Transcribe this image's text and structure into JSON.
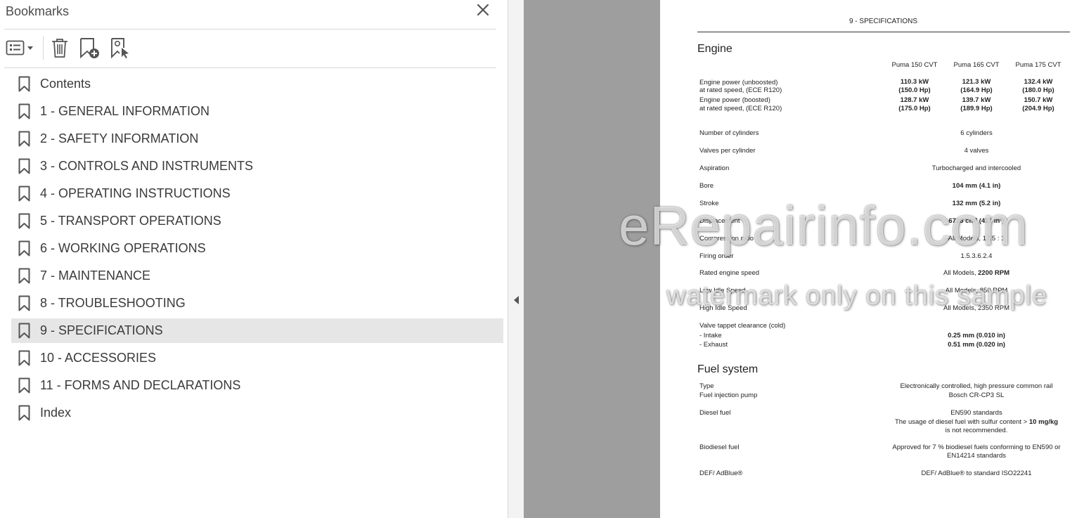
{
  "panel": {
    "title": "Bookmarks",
    "bookmarks": [
      {
        "label": "Contents"
      },
      {
        "label": "1 - GENERAL INFORMATION"
      },
      {
        "label": "2 - SAFETY INFORMATION"
      },
      {
        "label": "3 - CONTROLS AND INSTRUMENTS"
      },
      {
        "label": "4 - OPERATING INSTRUCTIONS"
      },
      {
        "label": "5 - TRANSPORT OPERATIONS"
      },
      {
        "label": "6 - WORKING OPERATIONS"
      },
      {
        "label": "7 - MAINTENANCE"
      },
      {
        "label": "8 - TROUBLESHOOTING"
      },
      {
        "label": "9 - SPECIFICATIONS",
        "selected": true
      },
      {
        "label": "10 - ACCESSORIES"
      },
      {
        "label": "11 - FORMS AND DECLARATIONS"
      },
      {
        "label": "Index"
      }
    ]
  },
  "page": {
    "header": "9 - SPECIFICATIONS",
    "engine": {
      "title": "Engine",
      "columns": [
        "Puma 150 CVT",
        "Puma 165 CVT",
        "Puma 175 CVT"
      ],
      "power_unboosted": {
        "label1": "Engine power (unboosted)",
        "label2": "at rated speed, (ECE R120)",
        "kw": [
          "110.3 kW",
          "121.3 kW",
          "132.4 kW"
        ],
        "hp": [
          "(150.0 Hp)",
          "(164.9 Hp)",
          "(180.0 Hp)"
        ]
      },
      "power_boosted": {
        "label1": "Engine power (boosted)",
        "label2": "at rated speed, (ECE R120)",
        "kw": [
          "128.7 kW",
          "139.7 kW",
          "150.7 kW"
        ],
        "hp": [
          "(175.0 Hp)",
          "(189.9 Hp)",
          "(204.9 Hp)"
        ]
      },
      "cylinders": {
        "label": "Number of cylinders",
        "value": "6 cylinders"
      },
      "valves": {
        "label": "Valves per cylinder",
        "value": "4 valves"
      },
      "aspiration": {
        "label": "Aspiration",
        "value": "Turbocharged and intercooled"
      },
      "bore": {
        "label": "Bore",
        "value": "104 mm (4.1 in)"
      },
      "stroke": {
        "label": "Stroke",
        "value": "132 mm (5.2 in)"
      },
      "displacement": {
        "label": "Displacement",
        "value": "6728 cm³ (411 in³)"
      },
      "compression": {
        "label": "Compression ratio",
        "value": "All Models, 17.5 : 1"
      },
      "firing": {
        "label": "Firing order",
        "value": "1.5.3.6.2.4"
      },
      "rated_speed": {
        "label": "Rated engine speed",
        "prefix": "All Models, ",
        "value": "2200 RPM"
      },
      "low_idle": {
        "label": "Low Idle Speed",
        "value": "All Models, 850 RPM"
      },
      "high_idle": {
        "label": "High Idle Speed",
        "value": "All Models, 2350 RPM"
      },
      "tappet": {
        "label": "Valve tappet clearance (cold)",
        "intake_label": "- Intake",
        "intake_value": "0.25 mm (0.010 in)",
        "exhaust_label": "- Exhaust",
        "exhaust_value": "0.51 mm (0.020 in)"
      }
    },
    "fuel": {
      "title": "Fuel system",
      "type": {
        "label": "Type",
        "value": "Electronically controlled, high pressure common rail"
      },
      "pump": {
        "label": "Fuel injection pump",
        "value": "Bosch CR-CP3 SL"
      },
      "diesel": {
        "label": "Diesel fuel",
        "line1": "EN590 standards",
        "line2a": "The usage of diesel fuel with sulfur content > ",
        "line2b": "10 mg/kg",
        "line3": "is not recommended."
      },
      "biodiesel": {
        "label": "Biodiesel fuel",
        "line1": "Approved for 7 % biodiesel fuels conforming to EN590 or",
        "line2": "EN14214 standards"
      },
      "def": {
        "label": "DEF/ AdBlue®",
        "value": "DEF/ AdBlue® to standard ISO22241"
      }
    }
  },
  "watermark": {
    "line1": "eRepairinfo.com",
    "line2": "watermark only on this sample"
  }
}
